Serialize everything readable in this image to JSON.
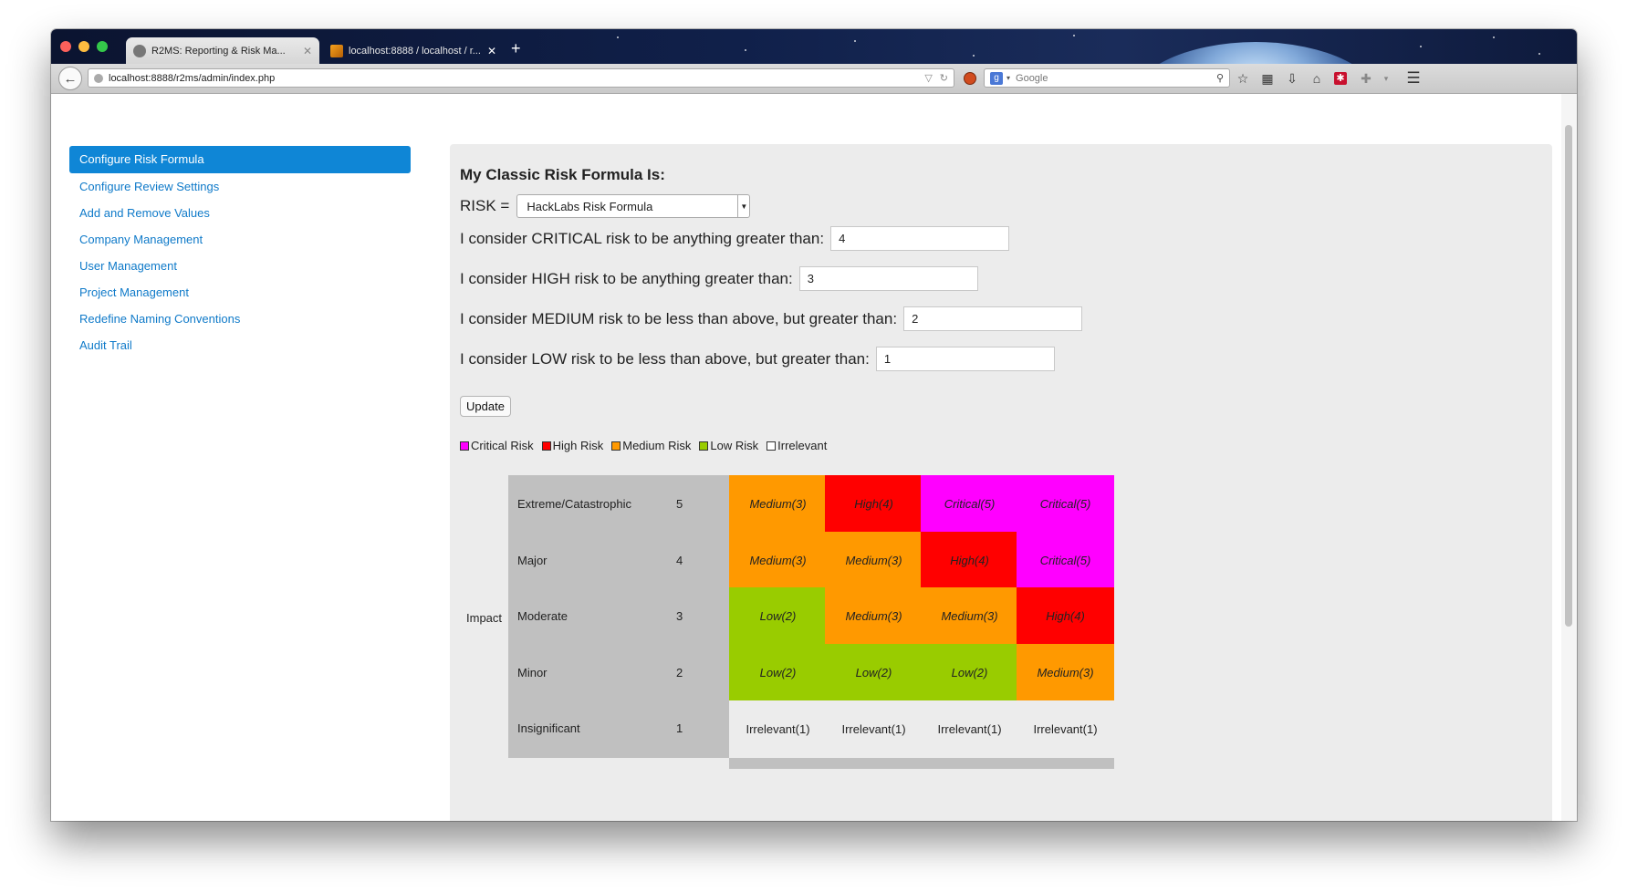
{
  "browser": {
    "tabs": [
      {
        "label": "R2MS: Reporting & Risk Ma...",
        "active": true
      },
      {
        "label": "localhost:8888 / localhost / r...",
        "active": false
      }
    ],
    "new_tab_label": "+",
    "tab_close_label": "✕",
    "url": "localhost:8888/r2ms/admin/index.php",
    "search_placeholder": "Google",
    "search_engine_badge": "g"
  },
  "sidebar": {
    "items": [
      {
        "label": "Configure Risk Formula",
        "active": true
      },
      {
        "label": "Configure Review Settings",
        "active": false
      },
      {
        "label": "Add and Remove Values",
        "active": false
      },
      {
        "label": "Company Management",
        "active": false
      },
      {
        "label": "User Management",
        "active": false
      },
      {
        "label": "Project Management",
        "active": false
      },
      {
        "label": "Redefine Naming Conventions",
        "active": false
      },
      {
        "label": "Audit Trail",
        "active": false
      }
    ]
  },
  "form": {
    "title": "My Classic Risk Formula Is:",
    "risk_label": "RISK =",
    "formula_selected": "HackLabs Risk Formula",
    "thresholds": [
      {
        "label": "I consider CRITICAL risk to be anything greater than:",
        "value": "4"
      },
      {
        "label": "I consider HIGH risk to be anything greater than:",
        "value": "3"
      },
      {
        "label": "I consider MEDIUM risk to be less than above, but greater than:",
        "value": "2"
      },
      {
        "label": "I consider LOW risk to be less than above, but greater than:",
        "value": "1"
      }
    ],
    "update_label": "Update"
  },
  "legend": [
    {
      "label": "Critical Risk",
      "color": "#ff00ff"
    },
    {
      "label": "High Risk",
      "color": "#ff0000"
    },
    {
      "label": "Medium Risk",
      "color": "#ff9900"
    },
    {
      "label": "Low Risk",
      "color": "#99cc00"
    },
    {
      "label": "Irrelevant",
      "color": "#ffffff"
    }
  ],
  "matrix": {
    "axis_label": "Impact",
    "rows": [
      {
        "name": "Extreme/Catastrophic",
        "score": "5",
        "cells": [
          {
            "text": "Medium(3)",
            "level": "medium"
          },
          {
            "text": "High(4)",
            "level": "high"
          },
          {
            "text": "Critical(5)",
            "level": "critical"
          },
          {
            "text": "Critical(5)",
            "level": "critical"
          }
        ]
      },
      {
        "name": "Major",
        "score": "4",
        "cells": [
          {
            "text": "Medium(3)",
            "level": "medium"
          },
          {
            "text": "Medium(3)",
            "level": "medium"
          },
          {
            "text": "High(4)",
            "level": "high"
          },
          {
            "text": "Critical(5)",
            "level": "critical"
          }
        ]
      },
      {
        "name": "Moderate",
        "score": "3",
        "cells": [
          {
            "text": "Low(2)",
            "level": "low"
          },
          {
            "text": "Medium(3)",
            "level": "medium"
          },
          {
            "text": "Medium(3)",
            "level": "medium"
          },
          {
            "text": "High(4)",
            "level": "high"
          }
        ]
      },
      {
        "name": "Minor",
        "score": "2",
        "cells": [
          {
            "text": "Low(2)",
            "level": "low"
          },
          {
            "text": "Low(2)",
            "level": "low"
          },
          {
            "text": "Low(2)",
            "level": "low"
          },
          {
            "text": "Medium(3)",
            "level": "medium"
          }
        ]
      },
      {
        "name": "Insignificant",
        "score": "1",
        "cells": [
          {
            "text": "Irrelevant(1)",
            "level": "irrelevant"
          },
          {
            "text": "Irrelevant(1)",
            "level": "irrelevant"
          },
          {
            "text": "Irrelevant(1)",
            "level": "irrelevant"
          },
          {
            "text": "Irrelevant(1)",
            "level": "irrelevant"
          }
        ]
      }
    ],
    "level_colors": {
      "critical": "#ff00ff",
      "high": "#ff0000",
      "medium": "#ff9900",
      "low": "#99cc00",
      "irrelevant": "#ececec"
    }
  }
}
